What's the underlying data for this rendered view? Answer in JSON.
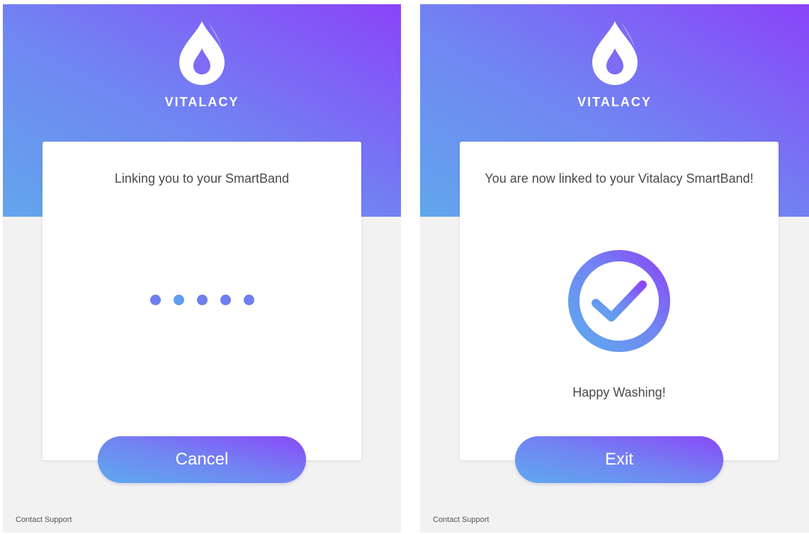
{
  "brand": {
    "name": "VITALACY",
    "gradient_colors": [
      "#62a6ec",
      "#7086f2",
      "#8a44f8"
    ]
  },
  "screens": [
    {
      "title": "Linking you to your SmartBand",
      "loading_dots": [
        "#6f7ef0",
        "#5f9ff0",
        "#6f7ef0",
        "#6f7ef0",
        "#6f7ef0"
      ],
      "button_label": "Cancel",
      "contact_label": "Contact Support"
    },
    {
      "title": "You are now linked to your Vitalacy SmartBand!",
      "status_icon": "checkmark-circle-icon",
      "message": "Happy Washing!",
      "button_label": "Exit",
      "contact_label": "Contact Support"
    }
  ]
}
